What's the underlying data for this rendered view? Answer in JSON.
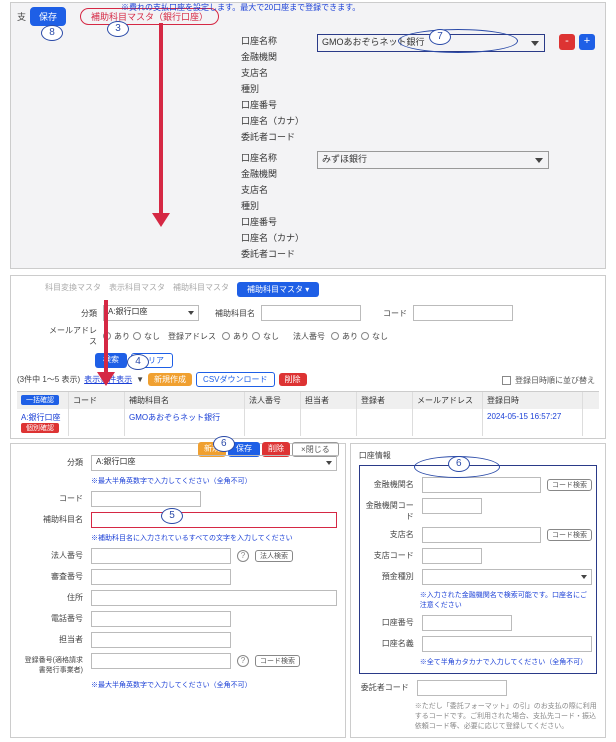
{
  "top": {
    "note": "※費れの支払口座を設定します。最大で20口座まで登録できます。",
    "prefix": "支",
    "save": "保存",
    "section_label": "補助科目マスタ（銀行口座）",
    "acct_labels": [
      "口座名称",
      "金融機関",
      "支店名",
      "種別",
      "口座番号",
      "口座名（カナ）",
      "委託者コード"
    ],
    "select1": "GMOあおぞらネット銀行",
    "select2": "みずほ銀行"
  },
  "mid": {
    "tabs": [
      "科目変換マスタ",
      "表示科目マスタ",
      "補助科目マスタ"
    ],
    "tab_active": "補助科目マスタ ▾",
    "f_bunrui": "分類",
    "bunrui_val": "A:銀行口座",
    "f_name": "補助科目名",
    "f_code": "コード",
    "f_mail": "メールアドレス",
    "r_ari": "あり",
    "r_nasi": "なし",
    "f_regaddr": "登録アドレス",
    "f_legal": "法人番号",
    "btn_search": "検索",
    "btn_clear": "クリア",
    "count": "(3件中 1〜5 表示)",
    "disp_cond": "表示条件表示",
    "btn_new": "新規作成 ",
    "btn_csv": "CSVダウンロード",
    "btn_del": "削除",
    "right_check": "登録日時順に並び替え",
    "headers": {
      "chk": "一括確認",
      "code": "コード",
      "name": "補助科目名",
      "legal": "法人番号",
      "resp": "担当者",
      "reg": "登録者",
      "mail": "メールアドレス",
      "date": "登録日時"
    },
    "row": {
      "bun": "A:銀行口座",
      "btn": "個別確認",
      "name": "GMOあおぞらネット銀行",
      "date": "2024-05-15 16:57:27"
    }
  },
  "left": {
    "badges": {
      "new": "新規",
      "save": "保存",
      "del": "削除",
      "close": "×閉じる"
    },
    "bunrui": "分類",
    "bunrui_val": "A:銀行口座",
    "code": "コード",
    "name": "補助科目名",
    "legal": "法人番号",
    "legal_btn": "法人検索",
    "kanri": "審査番号",
    "jusho": "住所",
    "tel": "電話番号",
    "resp": "担当者",
    "regno": "登録番号(適格請求書発行事業者)",
    "sub_btn": "コード検索",
    "hint_generic": "※最大半角英数字で入力してください（全角不可）",
    "hint_name": "※補助科目名に入力されているすべての文字を入力してください"
  },
  "right": {
    "title": "口座情報",
    "kikan": "金融機関名",
    "kikan_code": "金融機関コード",
    "siten": "支店名",
    "siten_code": "支店コード",
    "shubetsu": "預金種別",
    "hint1": "※入力された金融機関名で検索可能です。口座名にご注意ください",
    "acctno": "口座番号",
    "acctname": "口座名義",
    "hint2": "※全て半角カタカナで入力してください（全角不可）",
    "itaku": "委託者コード",
    "note": "※ただし「委託フォーマット」の引」のお支払の際に利用するコードです。ご利用された場合、支払先コード・振込依頼コード等、必要に応じて登録してください。",
    "btn": "コード検索"
  },
  "callouts": {
    "c3": "3",
    "c4": "4",
    "c5": "5",
    "c6": "6",
    "c7": "7",
    "c8": "8"
  }
}
